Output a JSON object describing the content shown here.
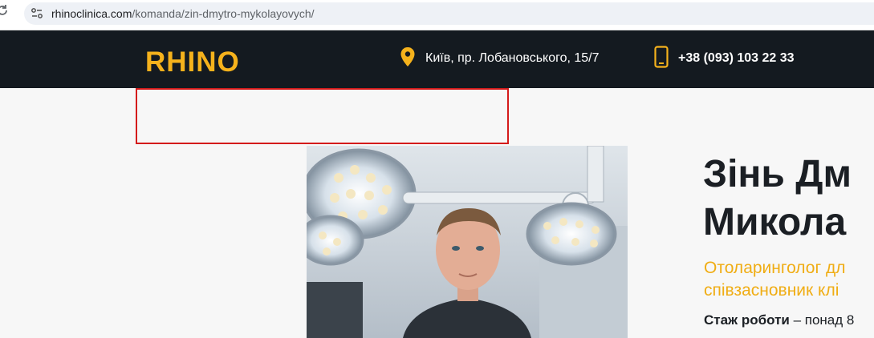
{
  "browser": {
    "url_host": "rhinoclinica.com",
    "url_path": "/komanda/zin-dmytro-mykolayovych/"
  },
  "header": {
    "logo_text": "RHINO",
    "address": "Київ, пр. Лобановського, 15/7",
    "phone": "+38 (093) 103 22 33",
    "accent_color": "#f5b21c",
    "background_color": "#141a20"
  },
  "doctor": {
    "name_line1": "Зінь Дм",
    "name_line2": "Микола",
    "role_line1": "Отоларинголог дл",
    "role_line2": "співзасновник клі",
    "experience_label": "Стаж роботи",
    "experience_value": " – понад 8"
  },
  "icons": {
    "reload": "reload-icon",
    "site_settings": "site-settings-icon",
    "location": "location-pin-icon",
    "phone": "phone-icon"
  }
}
